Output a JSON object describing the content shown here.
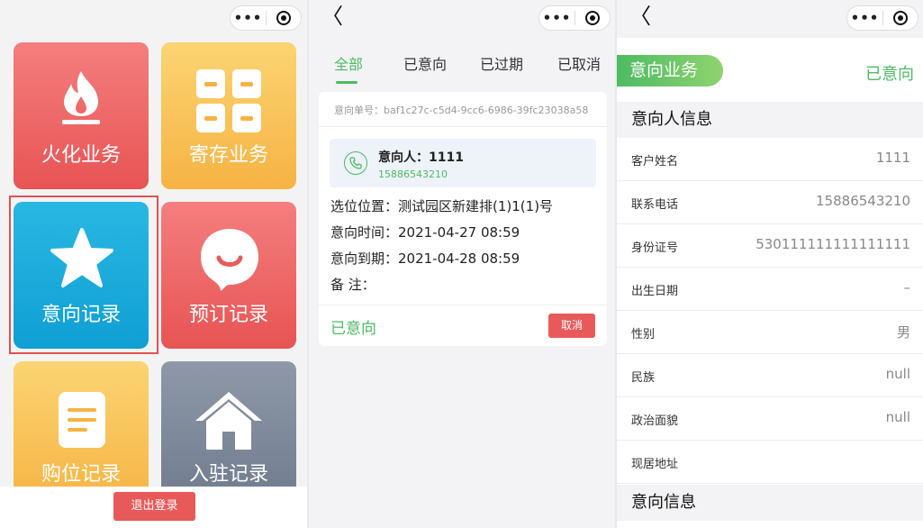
{
  "panel1": {
    "tiles": [
      {
        "label": "火化业务",
        "icon": "fire-icon"
      },
      {
        "label": "寄存业务",
        "icon": "grid-icon"
      },
      {
        "label": "意向记录",
        "icon": "star-icon"
      },
      {
        "label": "预订记录",
        "icon": "smile-bubble-icon"
      },
      {
        "label": "购位记录",
        "icon": "document-icon"
      },
      {
        "label": "入驻记录",
        "icon": "house-icon"
      }
    ],
    "logout_label": "退出登录"
  },
  "capsule": {
    "more": "•••"
  },
  "back_glyph": "〈",
  "panel2": {
    "tabs": [
      "全部",
      "已意向",
      "已过期",
      "已取消"
    ],
    "active_tab": "全部",
    "card": {
      "order_no": "意向单号：baf1c27c-c5d4-9cc6-6986-39fc23038a58",
      "person_label": "意向人：1111",
      "person_phone": "15886543210",
      "location": "选位位置：测试园区新建排(1)1(1)号",
      "intent_time": "意向时间：2021-04-27 08:59",
      "expire_time": "意向到期：2021-04-28 08:59",
      "remark": "备 注：",
      "status": "已意向",
      "cancel_label": "取消"
    }
  },
  "panel3": {
    "business_label": "意向业务",
    "status": "已意向",
    "section_person": "意向人信息",
    "fields": [
      {
        "key": "客户姓名",
        "value": "1111"
      },
      {
        "key": "联系电话",
        "value": "15886543210"
      },
      {
        "key": "身份证号",
        "value": "530111111111111111"
      },
      {
        "key": "出生日期",
        "value": "–"
      },
      {
        "key": "性别",
        "value": "男"
      },
      {
        "key": "民族",
        "value": "null"
      },
      {
        "key": "政治面貌",
        "value": "null"
      },
      {
        "key": "现居地址",
        "value": ""
      }
    ],
    "section_intent": "意向信息"
  },
  "colors": {
    "green": "#4dbb63",
    "red": "#e85a5a",
    "blue": "#0f9fd3",
    "yellow": "#f6b343",
    "gray": "#6f7b8e"
  }
}
